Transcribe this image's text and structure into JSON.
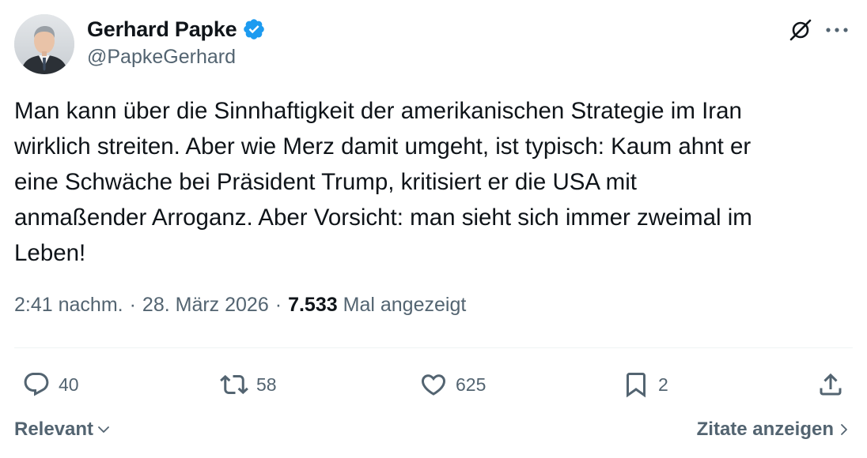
{
  "author": {
    "display_name": "Gerhard Papke",
    "handle": "@PapkeGerhard",
    "verified_color": "#1d9bf0"
  },
  "icons": {
    "verified": "verified-badge-icon",
    "grok": "grok-icon",
    "more": "more-icon",
    "reply": "reply-icon",
    "retweet": "retweet-icon",
    "like": "heart-icon",
    "bookmark": "bookmark-icon",
    "share": "share-icon"
  },
  "tweet": {
    "text": "Man kann über die Sinnhaftigkeit der amerikanischen Strategie im Iran\nwirklich streiten. Aber wie Merz damit umgeht, ist typisch: Kaum ahnt er\neine Schwäche bei Präsident Trump, kritisiert er die USA mit\nanmaßender Arroganz. Aber Vorsicht: man sieht sich immer zweimal im\nLeben!",
    "time": "2:41 nachm.",
    "separator": "·",
    "date": "28. März 2026",
    "views_count": "7.533",
    "views_label": "Mal angezeigt"
  },
  "actions": {
    "replies": "40",
    "retweets": "58",
    "likes": "625",
    "bookmarks": "2"
  },
  "footer": {
    "sort_label": "Relevant",
    "quotes_label": "Zitate anzeigen"
  },
  "colors": {
    "text_primary": "#0f1419",
    "text_secondary": "#536471",
    "divider": "#eff3f4"
  }
}
